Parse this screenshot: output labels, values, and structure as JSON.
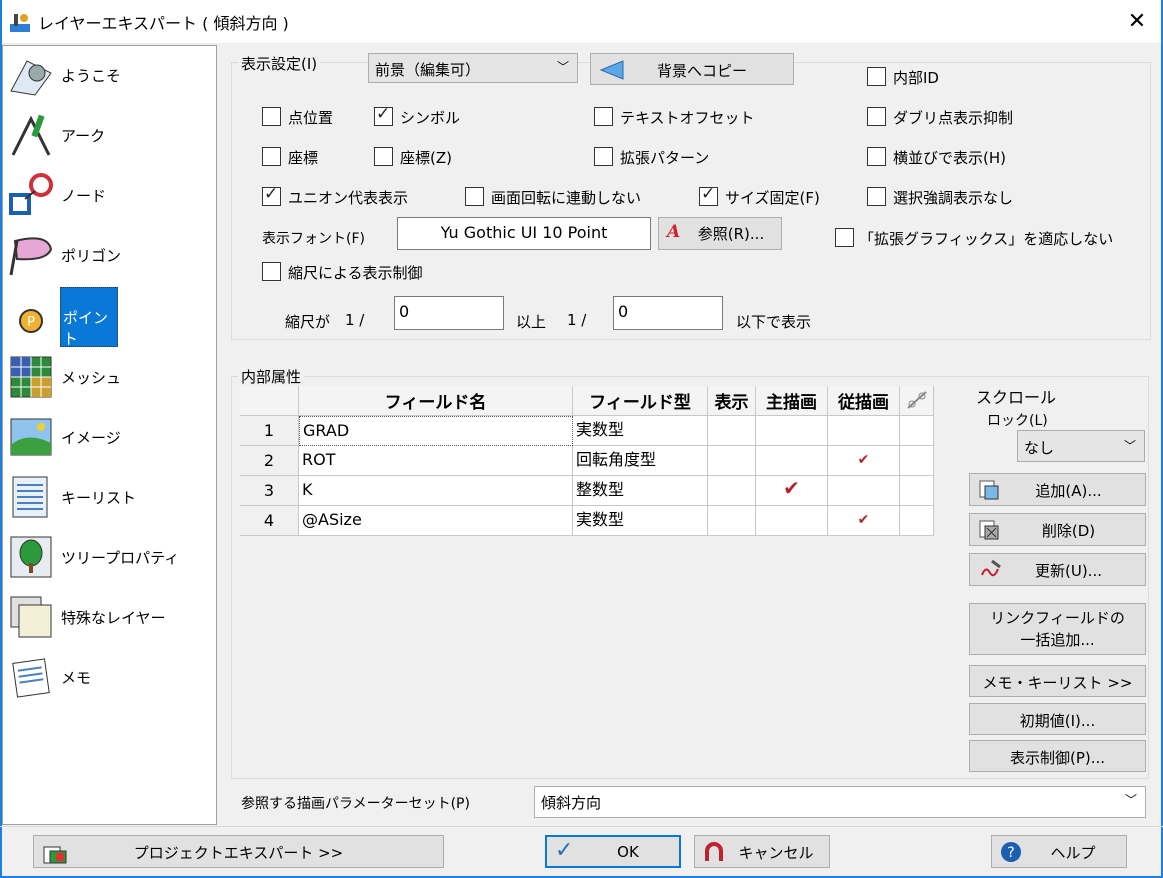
{
  "window": {
    "title": "レイヤーエキスパート ( 傾斜方向 )",
    "close": "✕"
  },
  "sidebar": {
    "items": [
      {
        "label": "ようこそ",
        "icon": "welcome-icon"
      },
      {
        "label": "アーク",
        "icon": "arc-icon"
      },
      {
        "label": "ノード",
        "icon": "node-icon"
      },
      {
        "label": "ポリゴン",
        "icon": "polygon-icon"
      },
      {
        "label": "ポイント",
        "icon": "point-icon",
        "selected": true
      },
      {
        "label": "メッシュ",
        "icon": "mesh-icon"
      },
      {
        "label": "イメージ",
        "icon": "image-icon"
      },
      {
        "label": "キーリスト",
        "icon": "keylist-icon"
      },
      {
        "label": "ツリープロパティ",
        "icon": "tree-icon"
      },
      {
        "label": "特殊なレイヤー",
        "icon": "special-layer-icon"
      },
      {
        "label": "メモ",
        "icon": "memo-icon"
      }
    ]
  },
  "display": {
    "group_label": "表示設定(I)",
    "mode_select": "前景（編集可）",
    "copy_button": "背景へコピー",
    "checkboxes": {
      "internal_id": {
        "label": "内部ID",
        "checked": false
      },
      "point_position": {
        "label": "点位置",
        "checked": false
      },
      "symbol": {
        "label": "シンボル",
        "checked": true
      },
      "text_offset": {
        "label": "テキストオフセット",
        "checked": false
      },
      "suppress_duplicates": {
        "label": "ダブリ点表示抑制",
        "checked": false
      },
      "coords": {
        "label": "座標",
        "checked": false
      },
      "coords_z": {
        "label": "座標(Z)",
        "checked": false
      },
      "ext_pattern": {
        "label": "拡張パターン",
        "checked": false
      },
      "horizontal": {
        "label": "横並びで表示(H)",
        "checked": false
      },
      "union_rep": {
        "label": "ユニオン代表表示",
        "checked": true
      },
      "no_rotate_link": {
        "label": "画面回転に連動しない",
        "checked": false
      },
      "fixed_size": {
        "label": "サイズ固定(F)",
        "checked": true
      },
      "no_select_highlight": {
        "label": "選択強調表示なし",
        "checked": false
      },
      "no_ext_graphics": {
        "label": "「拡張グラフィックス」を適応しない",
        "checked": false
      },
      "scale_control": {
        "label": "縮尺による表示制御",
        "checked": false
      }
    },
    "font_label": "表示フォント(F)",
    "font_value": "Yu Gothic UI 10 Point",
    "browse_button": "参照(R)...",
    "scale_prefix": "縮尺が",
    "scale_one_1": "1 /",
    "scale_min": "0",
    "scale_mid": "以上",
    "scale_one_2": "1 /",
    "scale_max": "0",
    "scale_suffix": "以下で表示"
  },
  "attributes": {
    "group_label": "内部属性",
    "columns": [
      "",
      "フィールド名",
      "フィールド型",
      "表示",
      "主描画",
      "従描画",
      ""
    ],
    "rows": [
      {
        "num": "1",
        "name": "GRAD",
        "type": "実数型",
        "show": "",
        "main": "",
        "sub": ""
      },
      {
        "num": "2",
        "name": "ROT",
        "type": "回転角度型",
        "show": "",
        "main": "",
        "sub": "✔"
      },
      {
        "num": "3",
        "name": "K",
        "type": "整数型",
        "show": "",
        "main": "✔",
        "sub": ""
      },
      {
        "num": "4",
        "name": "@ASize",
        "type": "実数型",
        "show": "",
        "main": "",
        "sub": "✔"
      }
    ],
    "scroll_lock_label_1": "スクロール",
    "scroll_lock_label_2": "ロック(L)",
    "scroll_lock_value": "なし",
    "add_button": "追加(A)...",
    "delete_button": "削除(D)",
    "update_button": "更新(U)...",
    "link_add_button_1": "リンクフィールドの",
    "link_add_button_2": "一括追加...",
    "memo_keylist_button": "メモ・キーリスト >>",
    "initial_button": "初期値(I)...",
    "display_control_button": "表示制御(P)..."
  },
  "param_set": {
    "label": "参照する描画パラメーターセット(P)",
    "value": "傾斜方向"
  },
  "footer": {
    "project_button": "プロジェクトエキスパート >>",
    "ok_button": "OK",
    "cancel_button": "キャンセル",
    "help_button": "ヘルプ"
  },
  "colors": {
    "accent": "#0a78d7",
    "check_red": "#b0262b"
  }
}
